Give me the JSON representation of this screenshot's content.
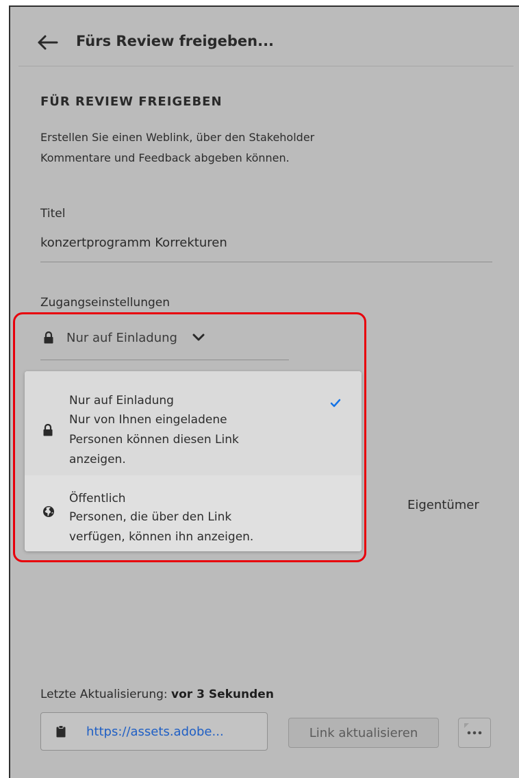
{
  "header": {
    "title": "Fürs Review freigeben..."
  },
  "section": {
    "title": "FÜR REVIEW FREIGEBEN",
    "description_line1": "Erstellen Sie einen Weblink, über den Stakeholder",
    "description_line2": "Kommentare und Feedback abgeben können."
  },
  "title_field": {
    "label": "Titel",
    "value": "konzertprogramm Korrekturen"
  },
  "access": {
    "label": "Zugangseinstellungen",
    "selected": "Nur auf Einladung",
    "options": [
      {
        "title": "Nur auf Einladung",
        "desc_line1": "Nur von Ihnen eingeladene",
        "desc_line2": "Personen können diesen Link",
        "desc_line3": "anzeigen.",
        "icon": "lock-icon",
        "selected": true
      },
      {
        "title": "Öffentlich",
        "desc_line1": "Personen, die über den Link",
        "desc_line2": "verfügen, können ihn anzeigen.",
        "icon": "globe-icon",
        "selected": false
      }
    ]
  },
  "owner_label": "Eigentümer",
  "footer": {
    "updated_label": "Letzte Aktualisierung:",
    "updated_value": "vor 3 Sekunden",
    "link": "https://assets.adobe...",
    "update_button": "Link aktualisieren"
  },
  "colors": {
    "panel_bg": "#bbbbbb",
    "popover_bg": "#dedede",
    "accent_blue": "#1473e6",
    "link_blue": "#1f5fc4",
    "highlight_red": "#e8000b"
  }
}
